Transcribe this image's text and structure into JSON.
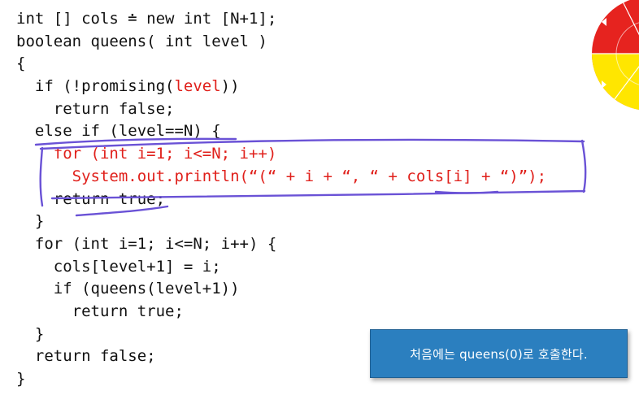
{
  "code": {
    "lines": [
      {
        "parts": [
          {
            "text": "int [] cols ≐ new int [N+1];",
            "color": "black"
          }
        ]
      },
      {
        "parts": [
          {
            "text": "boolean queens( int level )",
            "color": "black"
          }
        ]
      },
      {
        "parts": [
          {
            "text": "{",
            "color": "black"
          }
        ]
      },
      {
        "parts": [
          {
            "text": "  if (!promising(",
            "color": "black"
          },
          {
            "text": "level",
            "color": "red"
          },
          {
            "text": "))",
            "color": "black"
          }
        ]
      },
      {
        "parts": [
          {
            "text": "    return false;",
            "color": "black"
          }
        ]
      },
      {
        "parts": [
          {
            "text": "  else if (level==N) {",
            "color": "black"
          }
        ]
      },
      {
        "parts": [
          {
            "text": "    for (int i=1; i<=N; i++)",
            "color": "red"
          }
        ]
      },
      {
        "parts": [
          {
            "text": "      System.out.println(“(“ + i + “, “ + cols[i] + “)”);",
            "color": "red"
          }
        ]
      },
      {
        "parts": [
          {
            "text": "    return true;",
            "color": "black"
          }
        ]
      },
      {
        "parts": [
          {
            "text": "  }",
            "color": "black"
          }
        ]
      },
      {
        "parts": [
          {
            "text": "  for (int i=1; i<=N; i++) {",
            "color": "black"
          }
        ]
      },
      {
        "parts": [
          {
            "text": "    cols[level+1] = i;",
            "color": "black"
          }
        ]
      },
      {
        "parts": [
          {
            "text": "    if (queens(level+1))",
            "color": "black"
          }
        ]
      },
      {
        "parts": [
          {
            "text": "      return true;",
            "color": "black"
          }
        ]
      },
      {
        "parts": [
          {
            "text": "  }",
            "color": "black"
          }
        ]
      },
      {
        "parts": [
          {
            "text": "  return false;",
            "color": "black"
          }
        ]
      },
      {
        "parts": [
          {
            "text": "}",
            "color": "black"
          }
        ]
      }
    ]
  },
  "caption": {
    "text": "처음에는 queens(0)로 호출한다."
  },
  "colors": {
    "code_text": "#111111",
    "code_highlight": "#e0201b",
    "ink_annotation": "#6a52d6",
    "caption_bg": "#2b7fbf",
    "caption_text": "#ffffff",
    "wheel_red": "#e6231f",
    "wheel_yellow": "#ffe600"
  },
  "icons": {
    "wheel": "color-wheel-icon"
  }
}
